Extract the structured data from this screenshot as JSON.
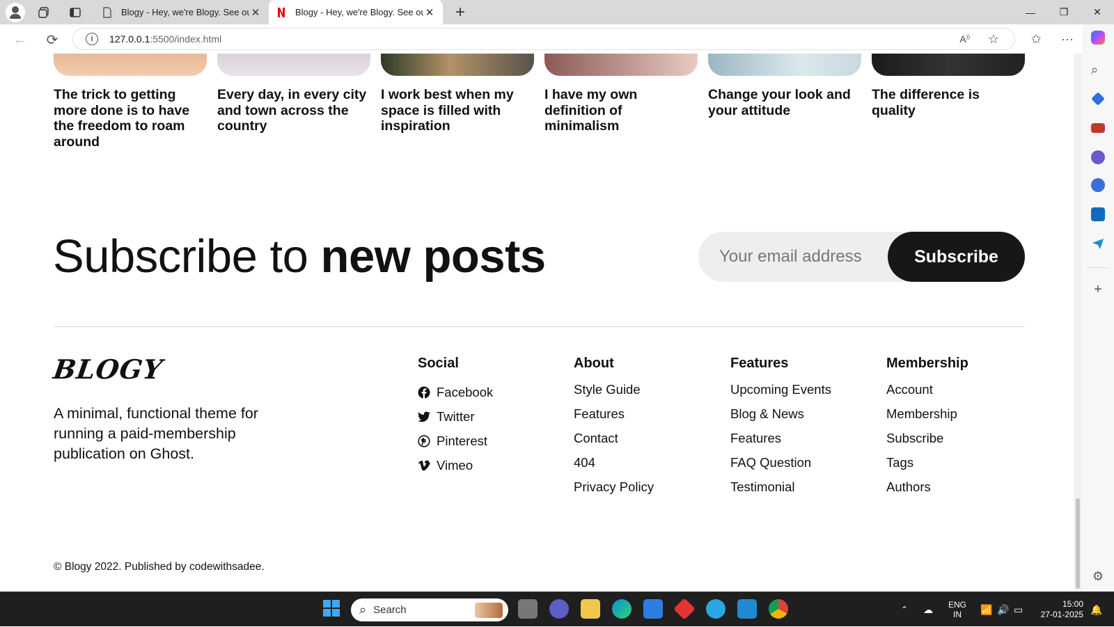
{
  "browser": {
    "tabs": [
      {
        "title": "Blogy - Hey, we're Blogy. See our",
        "active": false
      },
      {
        "title": "Blogy - Hey, we're Blogy. See our",
        "active": true
      }
    ],
    "url_host": "127.0.0.1",
    "url_path": ":5500/index.html"
  },
  "posts": [
    {
      "title": "The trick to getting more done is to have the freedom to roam around"
    },
    {
      "title": "Every day, in every city and town across the country"
    },
    {
      "title": "I work best when my space is filled with inspiration"
    },
    {
      "title": "I have my own definition of minimalism"
    },
    {
      "title": "Change your look and your attitude"
    },
    {
      "title": "The difference is quality"
    }
  ],
  "subscribe": {
    "heading_light": "Subscribe to ",
    "heading_bold": "new posts",
    "placeholder": "Your email address",
    "button": "Subscribe"
  },
  "footer": {
    "logo": "BLOGY",
    "tagline": "A minimal, functional theme for running a paid-membership publication on Ghost.",
    "social": {
      "heading": "Social",
      "items": [
        {
          "label": "Facebook",
          "icon": "facebook-icon"
        },
        {
          "label": "Twitter",
          "icon": "twitter-icon"
        },
        {
          "label": "Pinterest",
          "icon": "pinterest-icon"
        },
        {
          "label": "Vimeo",
          "icon": "vimeo-icon"
        }
      ]
    },
    "about": {
      "heading": "About",
      "items": [
        "Style Guide",
        "Features",
        "Contact",
        "404",
        "Privacy Policy"
      ]
    },
    "features": {
      "heading": "Features",
      "items": [
        "Upcoming Events",
        "Blog & News",
        "Features",
        "FAQ Question",
        "Testimonial"
      ]
    },
    "membership": {
      "heading": "Membership",
      "items": [
        "Account",
        "Membership",
        "Subscribe",
        "Tags",
        "Authors"
      ]
    },
    "copyright": "© Blogy 2022. Published by codewithsadee."
  },
  "taskbar": {
    "search_label": "Search",
    "lang_top": "ENG",
    "lang_bottom": "IN",
    "time": "15:00",
    "date": "27-01-2025"
  },
  "colors": {
    "accent_dark": "#171717",
    "input_bg": "#eeeeee"
  }
}
